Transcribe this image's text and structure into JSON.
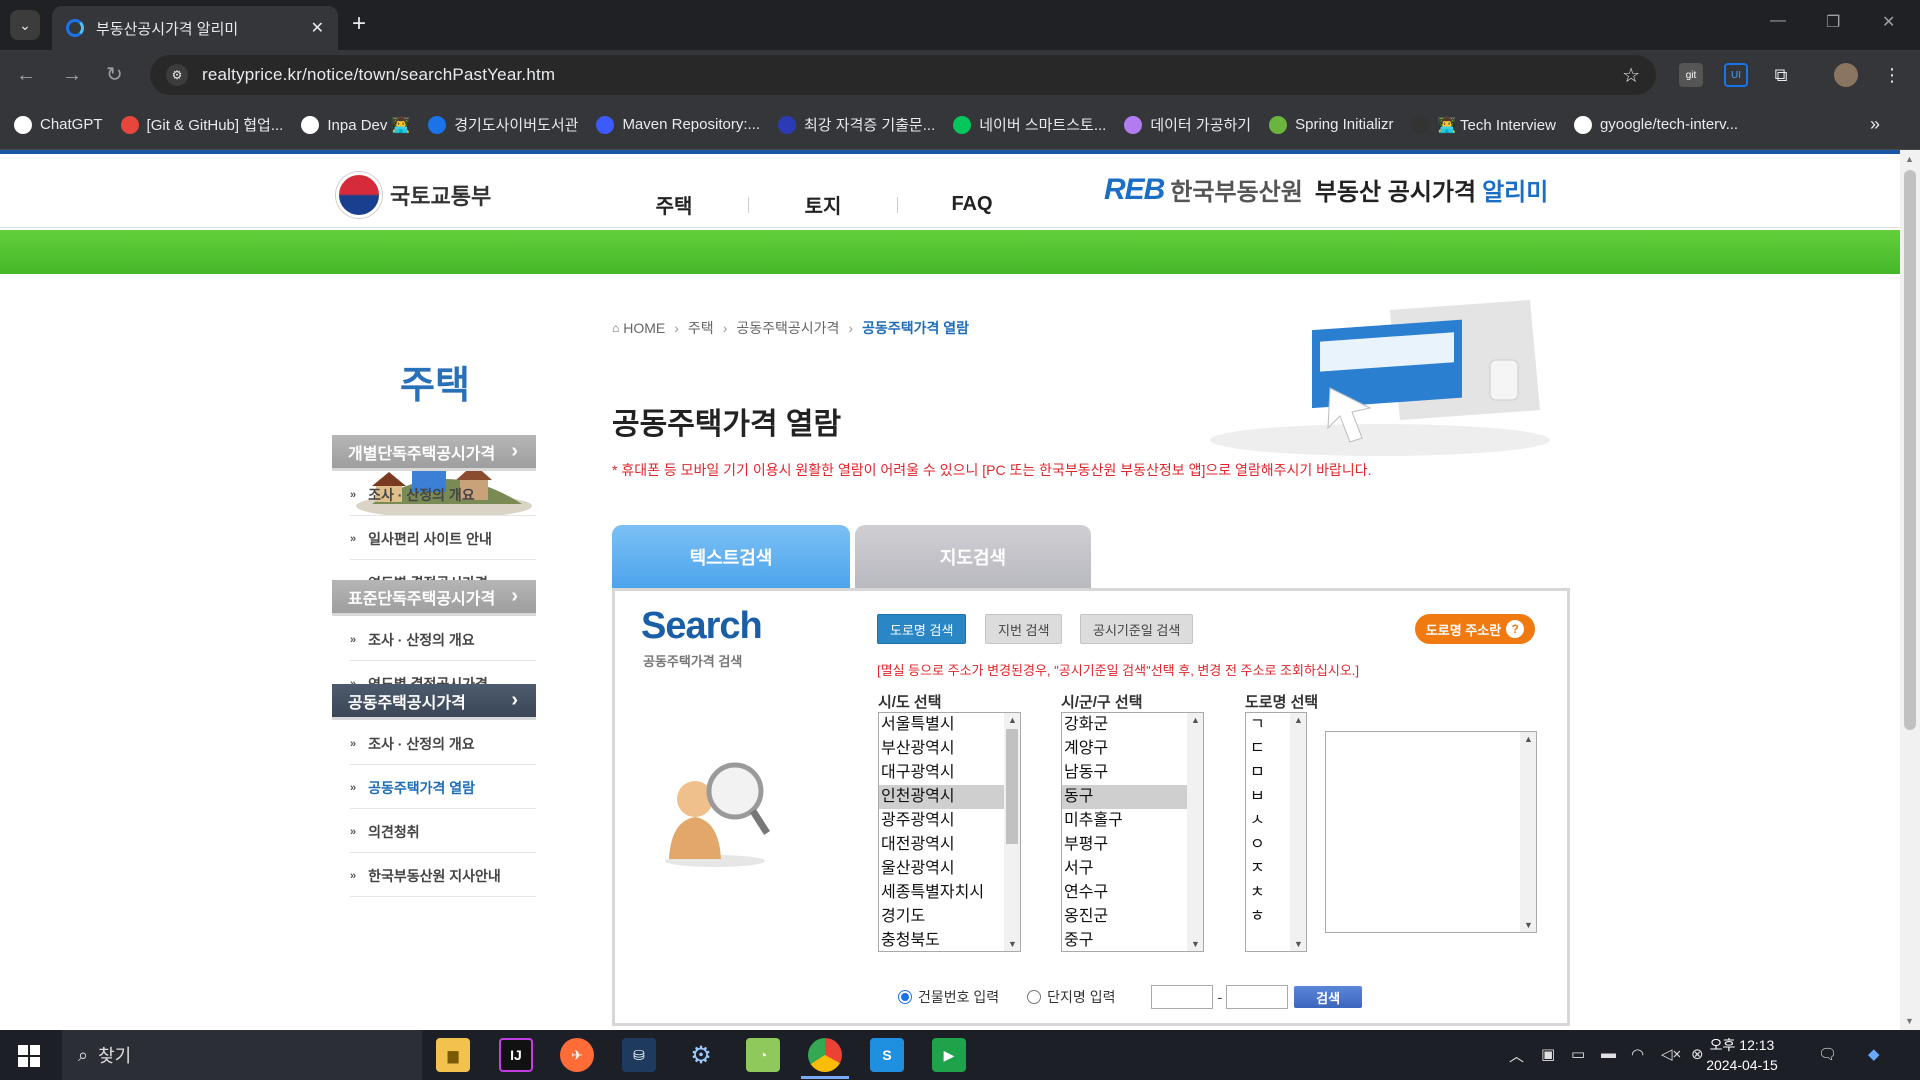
{
  "browser": {
    "tab_title": "부동산공시가격 알리미",
    "url": "realtyprice.kr/notice/town/searchPastYear.htm",
    "bookmarks": [
      "ChatGPT",
      "[Git & GitHub] 협업...",
      "Inpa Dev 👨‍💻",
      "경기도사이버도서관",
      "Maven Repository:...",
      "최강 자격증 기출문...",
      "네이버 스마트스토...",
      "데이터 가공하기",
      "Spring Initializr",
      "👨‍💻 Tech Interview",
      "gyoogle/tech-interv..."
    ],
    "bookmark_colors": [
      "#ffffff",
      "#e8453c",
      "#ffffff",
      "#1a73e8",
      "#3d5afe",
      "#2b3bb5",
      "#03c75a",
      "#b07cf0",
      "#6db33f",
      "#333333",
      "#ffffff"
    ],
    "more": "»"
  },
  "site": {
    "ministry": "국토교통부",
    "gnb": [
      "주택",
      "토지",
      "FAQ"
    ],
    "reb_mark": "REB",
    "reb_name": "한국부동산원",
    "service_name": "부동산 공시가격",
    "service_name_accent": "알리미",
    "accent_color": "#1a6fc4",
    "band_color": "#4cbf2e"
  },
  "sidebar": {
    "title": "주택",
    "groups": [
      {
        "label": "개별단독주택공시가격",
        "items": [
          "조사 · 산정의 개요",
          "일사편리 사이트 안내",
          "연도별 결정공시가격"
        ]
      },
      {
        "label": "표준단독주택공시가격",
        "items": [
          "조사 · 산정의 개요",
          "연도별 결정공시가격"
        ]
      },
      {
        "label": "공동주택공시가격",
        "items": [
          "조사 · 산정의 개요",
          "공동주택가격 열람",
          "의견청취",
          "한국부동산원 지사안내"
        ]
      }
    ]
  },
  "content": {
    "breadcrumb": [
      "HOME",
      "주택",
      "공동주택공시가격",
      "공동주택가격 열람"
    ],
    "title": "공동주택가격 열람",
    "notice": "* 휴대폰 등 모바일 기기 이용시 원활한 열람이 어려울 수 있으니 [PC 또는 한국부동산원 부동산정보 앱]으로 열람해주시기 바랍니다.",
    "tabs": [
      "텍스트검색",
      "지도검색"
    ],
    "search": {
      "logo": "Search",
      "logo_sub": "공동주택가격 검색",
      "modes": [
        "도로명 검색",
        "지번 검색",
        "공시기준일 검색"
      ],
      "road_help": "도로명 주소란",
      "warning": "[멸실 등으로 주소가 변경된경우, \"공시기준일 검색\"선택 후, 변경 전 주소로 조회하십시오.]",
      "sido_label": "시/도 선택",
      "sido": [
        "서울특별시",
        "부산광역시",
        "대구광역시",
        "인천광역시",
        "광주광역시",
        "대전광역시",
        "울산광역시",
        "세종특별자치시",
        "경기도",
        "충청북도"
      ],
      "sido_selected": "인천광역시",
      "sigungu_label": "시/군/구 선택",
      "sigungu": [
        "강화군",
        "계양구",
        "남동구",
        "동구",
        "미추홀구",
        "부평구",
        "서구",
        "연수구",
        "옹진군",
        "중구"
      ],
      "sigungu_selected": "동구",
      "road_label": "도로명 선택",
      "initials": [
        "ㄱ",
        "ㄷ",
        "ㅁ",
        "ㅂ",
        "ㅅ",
        "ㅇ",
        "ㅈ",
        "ㅊ",
        "ㅎ"
      ],
      "radio_building": "건물번호 입력",
      "radio_complex": "단지명 입력",
      "radio_selected": "건물번호 입력",
      "dash": "-",
      "search_btn": "검색"
    }
  },
  "taskbar": {
    "search": "찾기",
    "time": "오후 12:13",
    "date": "2024-04-15"
  }
}
